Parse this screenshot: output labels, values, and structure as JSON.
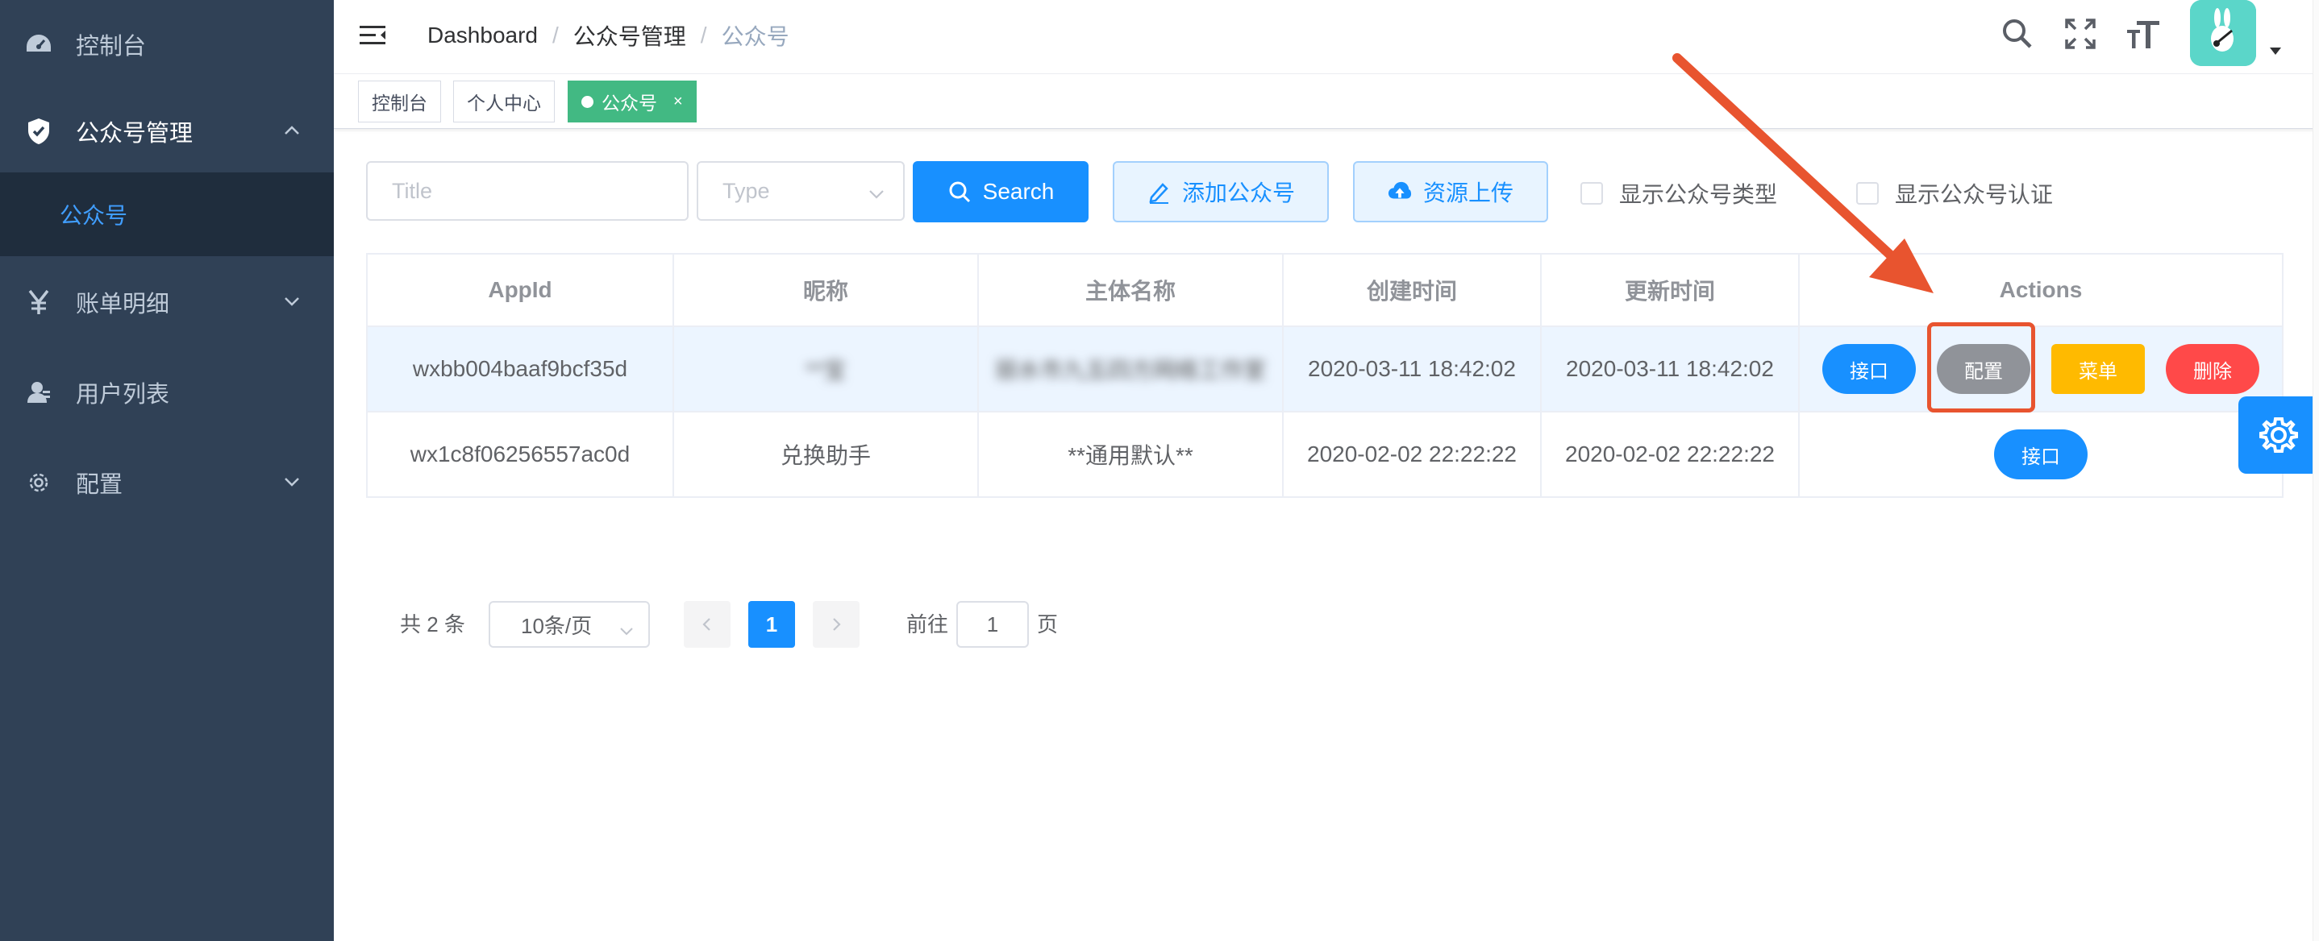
{
  "sidebar": {
    "items": [
      {
        "label": "控制台",
        "icon": "dashboard-icon"
      },
      {
        "label": "公众号管理",
        "icon": "shield-icon"
      },
      {
        "label": "公众号"
      },
      {
        "label": "账单明细",
        "icon": "yen-icon"
      },
      {
        "label": "用户列表",
        "icon": "user-icon"
      },
      {
        "label": "配置",
        "icon": "gear-icon"
      }
    ]
  },
  "breadcrumb": {
    "items": [
      "Dashboard",
      "公众号管理",
      "公众号"
    ],
    "separator": "/"
  },
  "tags": [
    {
      "label": "控制台"
    },
    {
      "label": "个人中心"
    },
    {
      "label": "公众号",
      "close": "×"
    }
  ],
  "filters": {
    "title_placeholder": "Title",
    "type_placeholder": "Type",
    "search_label": "Search",
    "add_label": "添加公众号",
    "upload_label": "资源上传",
    "show_type_label": "显示公众号类型",
    "show_cert_label": "显示公众号认证"
  },
  "table": {
    "headers": [
      "AppId",
      "昵称",
      "主体名称",
      "创建时间",
      "更新时间",
      "Actions"
    ],
    "rows": [
      {
        "appid": "wxbb004baaf9bcf35d",
        "nickname": "**宝",
        "subject": "丽水市九五四方网络工作室",
        "created": "2020-03-11 18:42:02",
        "updated": "2020-03-11 18:42:02",
        "actions": [
          "接口",
          "配置",
          "菜单",
          "删除"
        ]
      },
      {
        "appid": "wx1c8f06256557ac0d",
        "nickname": "兑换助手",
        "subject": "**通用默认**",
        "created": "2020-02-02 22:22:22",
        "updated": "2020-02-02 22:22:22",
        "actions": [
          "接口"
        ]
      }
    ]
  },
  "pagination": {
    "total_text": "共 2 条",
    "page_size": "10条/页",
    "current_page": "1",
    "goto_prefix": "前往",
    "goto_value": "1",
    "goto_suffix": "页"
  },
  "colors": {
    "sidebar_bg": "#304156",
    "primary": "#1890ff",
    "tag_active": "#42b983",
    "highlight": "#e8542f"
  }
}
